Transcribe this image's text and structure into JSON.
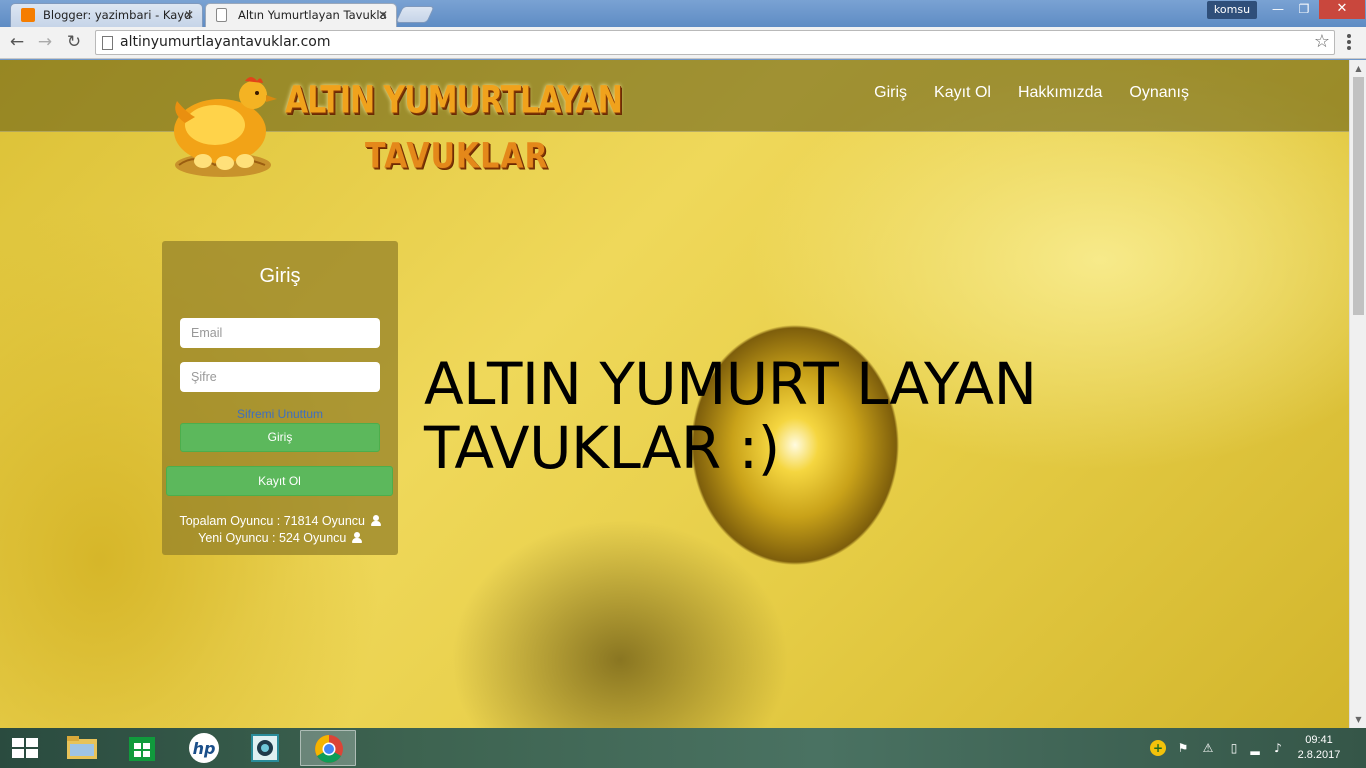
{
  "browser": {
    "tabs": [
      {
        "title": "Blogger: yazimbari - Kayd",
        "close": "✕",
        "active": false
      },
      {
        "title": "Altın Yumurtlayan Tavukla",
        "close": "✕",
        "active": true
      }
    ],
    "profile": "komsu",
    "url": "altinyumurtlayantavuklar.com",
    "window_controls": {
      "minimize": "—",
      "restore": "❐",
      "close": "✕"
    }
  },
  "site": {
    "logo": {
      "line1": "ALTIN YUMURTLAYAN",
      "line2": "TAVUKLAR"
    },
    "nav": [
      "Giriş",
      "Kayıt Ol",
      "Hakkımızda",
      "Oynanış"
    ],
    "login": {
      "title": "Giriş",
      "email_placeholder": "Email",
      "password_placeholder": "Şifre",
      "forgot": "Sifremi Unuttum",
      "login_button": "Giriş",
      "register_button": "Kayıt Ol",
      "total_players": "Topalam Oyuncu : 71814 Oyuncu",
      "new_players": "Yeni Oyuncu : 524 Oyuncu"
    },
    "hero_text": "ALTIN YUMURT LAYAN TAVUKLAR :)"
  },
  "taskbar": {
    "time": "09:41",
    "date": "2.8.2017"
  },
  "colors": {
    "accent_green": "#5cb85c",
    "link_blue": "#3e6fc0",
    "taskbar": "#3d6350"
  }
}
